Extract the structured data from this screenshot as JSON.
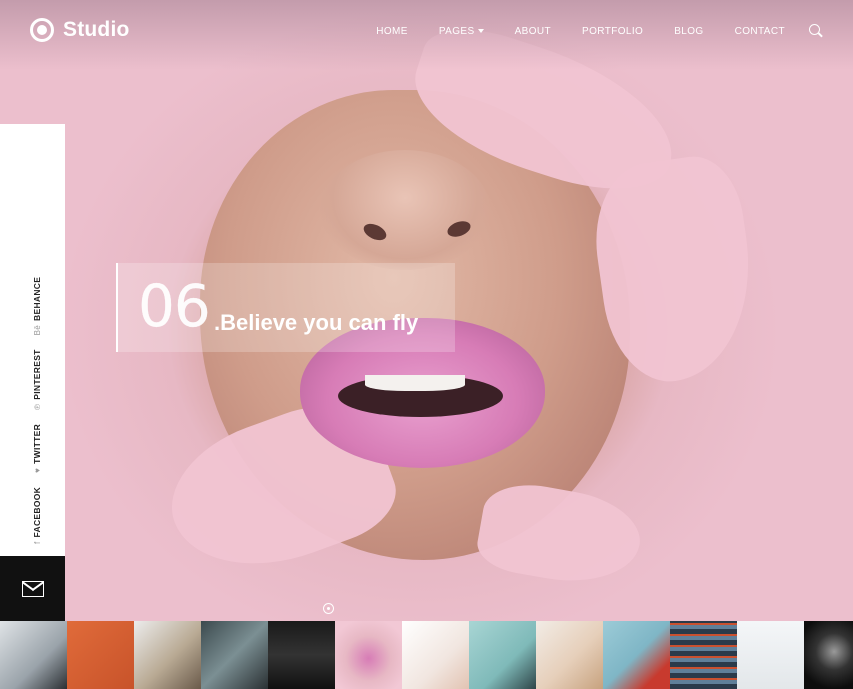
{
  "header": {
    "brand": "Studio",
    "nav": [
      {
        "label": "HOME",
        "has_dropdown": false
      },
      {
        "label": "PAGES",
        "has_dropdown": true
      },
      {
        "label": "ABOUT",
        "has_dropdown": false
      },
      {
        "label": "PORTFOLIO",
        "has_dropdown": false
      },
      {
        "label": "BLOG",
        "has_dropdown": false
      },
      {
        "label": "CONTACT",
        "has_dropdown": false
      }
    ],
    "search_icon": "search-icon"
  },
  "social": [
    {
      "label": "FACEBOOK",
      "glyph": "f"
    },
    {
      "label": "TWITTER",
      "glyph": "♥"
    },
    {
      "label": "PINTEREST",
      "glyph": "℗"
    },
    {
      "label": "BEHANCE",
      "glyph": "Bē"
    }
  ],
  "mail": {
    "icon": "envelope-icon"
  },
  "slide": {
    "number": "06",
    "title": ".Believe you can fly"
  },
  "thumbnails": [
    {
      "name": "thumb-dancer",
      "bg": "linear-gradient(135deg,#dfe3e6,#9aa3aa 60%,#2b2f33)"
    },
    {
      "name": "thumb-orange-window",
      "bg": "linear-gradient(135deg,#e06b3a,#c8532a)"
    },
    {
      "name": "thumb-deer",
      "bg": "linear-gradient(135deg,#ececec,#b9aa94 55%,#6a5a4a)"
    },
    {
      "name": "thumb-shoes",
      "bg": "linear-gradient(135deg,#3c4a4e,#7b8f93 50%,#2a3033)"
    },
    {
      "name": "thumb-dark-lines",
      "bg": "linear-gradient(180deg,#1a1a1a,#333 50%,#111)"
    },
    {
      "name": "thumb-pink-lips",
      "bg": "radial-gradient(circle at 50% 55%,#d77cb6 0%,#e7b8c4 45%,#f2c8d5 80%)"
    },
    {
      "name": "thumb-hand",
      "bg": "linear-gradient(135deg,#ffffff,#f1e6e0 60%,#e2c3b2)"
    },
    {
      "name": "thumb-teal-figure",
      "bg": "linear-gradient(135deg,#a8d5d4,#7fbab9 60%,#2e4548)"
    },
    {
      "name": "thumb-blonde-portrait",
      "bg": "linear-gradient(135deg,#f2ece6,#e6cfba 55%,#c7a27e)"
    },
    {
      "name": "thumb-red-building",
      "bg": "linear-gradient(135deg,#9ccbd7,#7fb6c6 50%,#c83a2e 80%)"
    },
    {
      "name": "thumb-blue-facade",
      "bg": "repeating-linear-gradient(0deg,#2a3a4a 0 5px,#5f7f99 5px 9px,#c9502f 9px 11px)"
    },
    {
      "name": "thumb-snow-walker",
      "bg": "linear-gradient(180deg,#f4f6f8,#e3e7ea)"
    },
    {
      "name": "thumb-smoke",
      "bg": "radial-gradient(circle at 45% 45%,#9a9a9a 0%,#333 35%,#0d0d0d 70%)"
    }
  ]
}
